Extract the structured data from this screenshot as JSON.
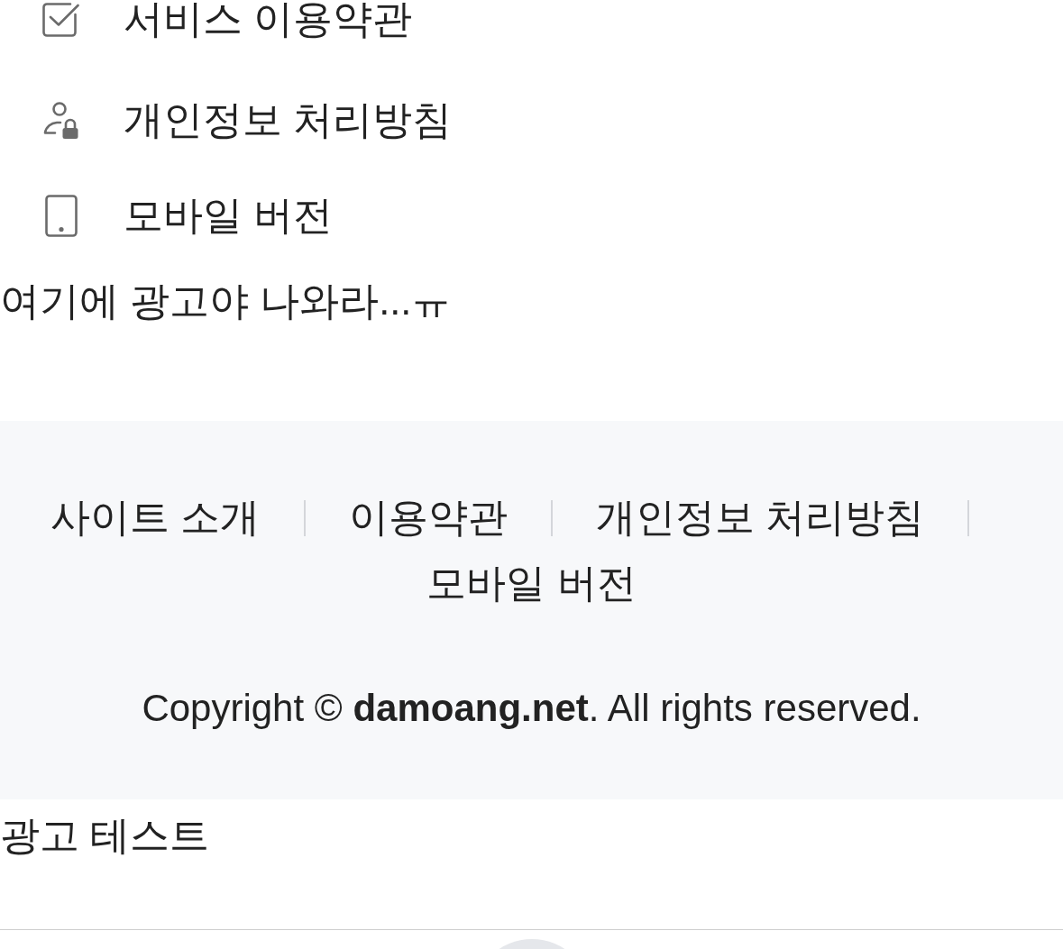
{
  "menu_items": [
    {
      "label": "서비스 이용약관"
    },
    {
      "label": "개인정보 처리방침"
    },
    {
      "label": "모바일 버전"
    }
  ],
  "ad_text": "여기에 광고야 나와라...ㅠ",
  "footer": {
    "links": [
      "사이트 소개",
      "이용약관",
      "개인정보 처리방침",
      "모바일 버전"
    ],
    "copyright": "Copyright © **damoang.net**. All rights reserved."
  },
  "ad_test": "광고 테스트"
}
